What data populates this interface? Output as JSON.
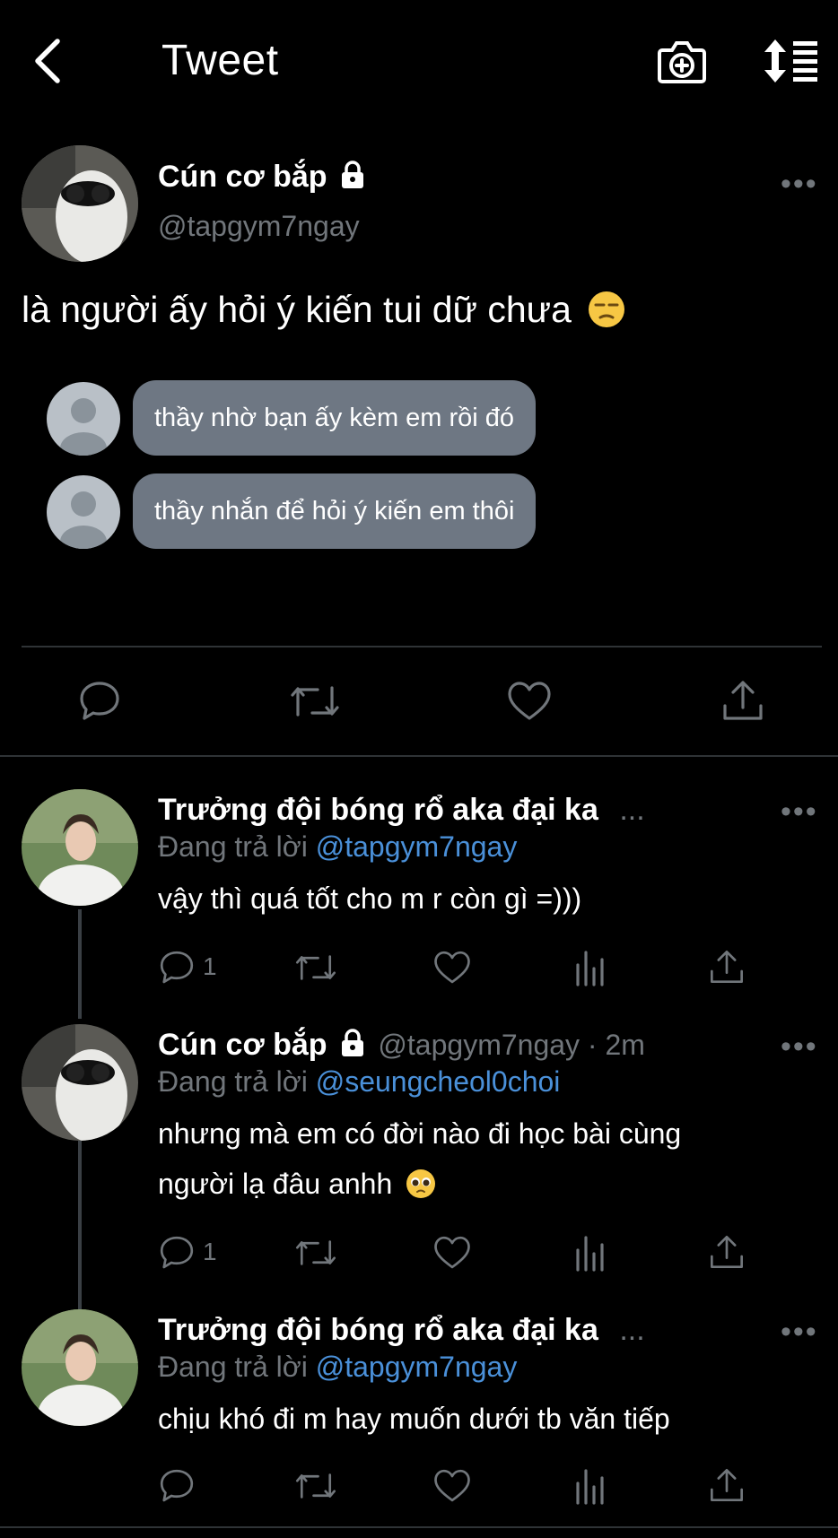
{
  "header": {
    "title": "Tweet"
  },
  "main_tweet": {
    "author": "Cún cơ bắp",
    "handle": "@tapgym7ngay",
    "text": "là người ấy hỏi ý kiến tui dữ chưa",
    "bubbles": [
      "thầy nhờ bạn ấy kèm em rồi đó",
      "thầy nhắn để hỏi ý kiến em thôi"
    ]
  },
  "replies": [
    {
      "author": "Trưởng đội bóng rổ aka đại ka",
      "ellipsis": "...",
      "replying_prefix": "Đang trả lời",
      "replying_to": "@tapgym7ngay",
      "text": "vậy thì quá tốt cho m r còn gì =)))",
      "reply_count": "1"
    },
    {
      "author": "Cún cơ bắp",
      "meta": "@tapgym7ngay · 2m",
      "replying_prefix": "Đang trả lời",
      "replying_to": "@seungcheol0choi",
      "text_line1": "nhưng mà em có đời nào đi học bài cùng",
      "text_line2": "người lạ đâu anhh",
      "reply_count": "1"
    },
    {
      "author": "Trưởng đội bóng rổ aka đại ka",
      "ellipsis": "...",
      "replying_prefix": "Đang trả lời",
      "replying_to": "@tapgym7ngay",
      "text": "chịu khó đi m hay muốn dưới tb văn tiếp"
    }
  ],
  "colors": {
    "accent": "#4a90d9",
    "muted": "#71767b",
    "bubble": "#6e7783"
  }
}
